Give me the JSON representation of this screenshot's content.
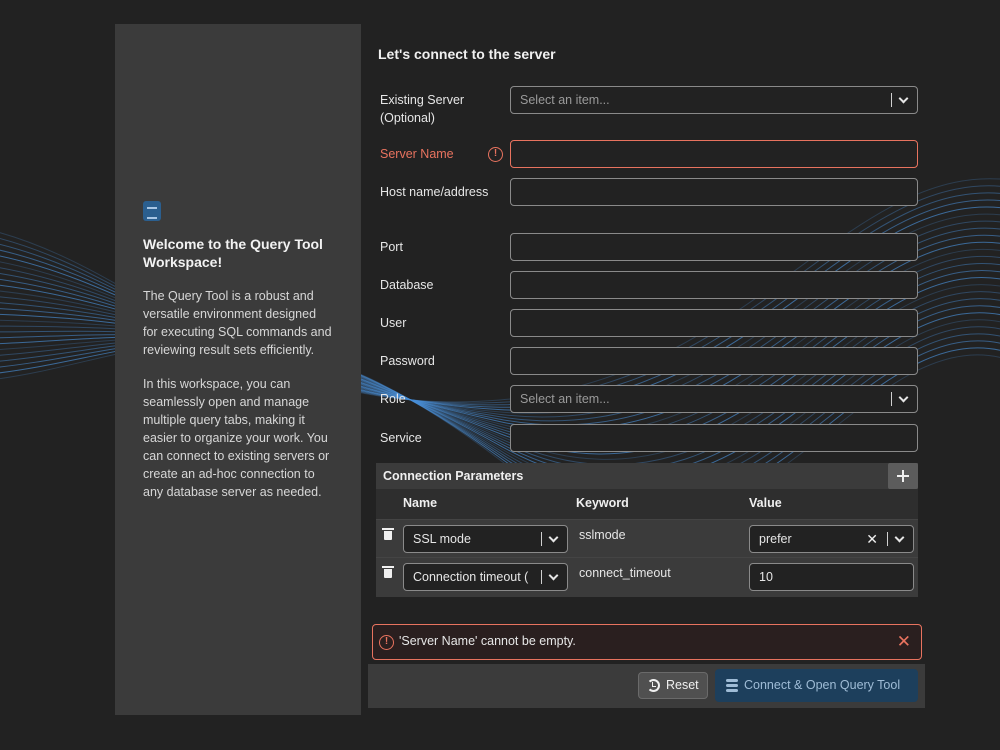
{
  "welcome": {
    "title": "Welcome to the Query Tool Workspace!",
    "para1": "The Query Tool is a robust and versatile environment designed for executing SQL commands and reviewing result sets efficiently.",
    "para2": "In this workspace, you can seamlessly open and manage multiple query tabs, making it easier to organize your work. You can connect to existing servers or create an ad-hoc connection to any database server as needed."
  },
  "form": {
    "heading": "Let's connect to the server",
    "existing_server": {
      "label": "Existing Server (Optional)",
      "placeholder": "Select an item..."
    },
    "server_name": {
      "label": "Server Name",
      "value": ""
    },
    "host": {
      "label": "Host name/address",
      "value": ""
    },
    "port": {
      "label": "Port",
      "value": ""
    },
    "database": {
      "label": "Database",
      "value": ""
    },
    "user": {
      "label": "User",
      "value": ""
    },
    "password": {
      "label": "Password",
      "value": ""
    },
    "role": {
      "label": "Role",
      "placeholder": "Select an item..."
    },
    "service": {
      "label": "Service",
      "value": ""
    }
  },
  "params": {
    "title": "Connection Parameters",
    "columns": {
      "name": "Name",
      "keyword": "Keyword",
      "value": "Value"
    },
    "rows": [
      {
        "name": "SSL mode",
        "keyword": "sslmode",
        "value": "prefer"
      },
      {
        "name": "Connection timeout (",
        "keyword": "connect_timeout",
        "value": "10"
      }
    ]
  },
  "error": {
    "message": "'Server Name' cannot be empty."
  },
  "footer": {
    "reset_label": "Reset",
    "connect_label": "Connect & Open Query Tool"
  },
  "colors": {
    "background": "#222222",
    "panel": "#3b3b3b",
    "error": "#e8735f",
    "primary": "#1d3f5c",
    "wave": "#4a90d9"
  },
  "icons": [
    "info-icon",
    "error-icon",
    "chevron-down-icon",
    "plus-icon",
    "trash-icon",
    "clear-icon",
    "close-icon",
    "reset-icon",
    "database-icon"
  ]
}
